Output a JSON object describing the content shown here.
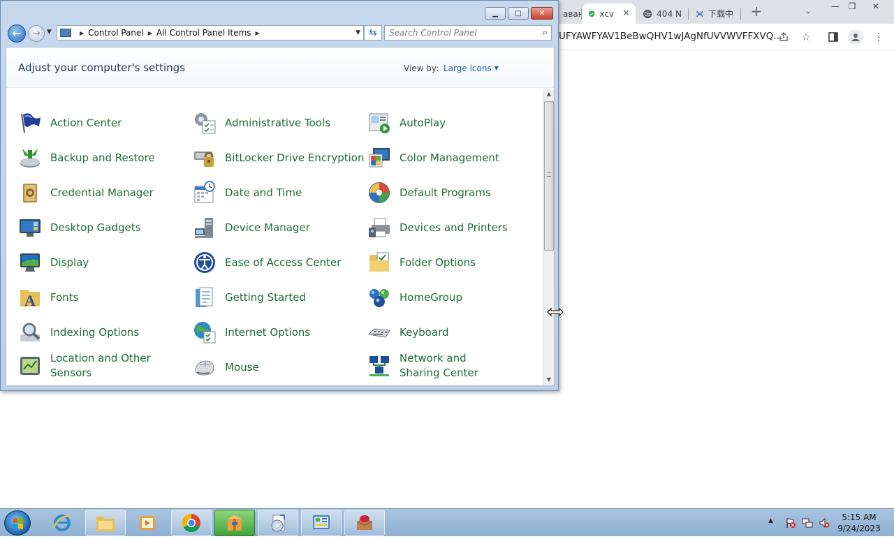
{
  "browser": {
    "tabs": [
      {
        "title": "аван",
        "close": ""
      },
      {
        "title": "xcv",
        "close": "✕"
      },
      {
        "title": "404 N",
        "close": ""
      },
      {
        "title": "下载中",
        "close": ""
      }
    ],
    "new_tab": "+",
    "tab_list": "⌄",
    "url": "UFYAWFYAV1BeBwQHV1wJAgNfUVVWVFFXVQ...",
    "controls": {
      "minimize": "—",
      "restore": "❐",
      "close": "✕"
    }
  },
  "control_panel": {
    "window_buttons": {
      "minimize": "▁",
      "maximize": "□",
      "close": "✕"
    },
    "breadcrumb": [
      "Control Panel",
      "All Control Panel Items"
    ],
    "search_placeholder": "Search Control Panel",
    "heading": "Adjust your computer's settings",
    "view_by_label": "View by:",
    "view_by_value": "Large icons",
    "items": [
      {
        "label": "Action Center",
        "icon": "flag-icon",
        "color": "#1f3f9a"
      },
      {
        "label": "Administrative Tools",
        "icon": "admin-tools-icon",
        "color": "#6b7b8c"
      },
      {
        "label": "AutoPlay",
        "icon": "autoplay-icon",
        "color": "#2f9a3c"
      },
      {
        "label": "Backup and Restore",
        "icon": "backup-icon",
        "color": "#3aa14a"
      },
      {
        "label": "BitLocker Drive Encryption",
        "icon": "bitlocker-icon",
        "color": "#c8a13a"
      },
      {
        "label": "Color Management",
        "icon": "color-management-icon",
        "color": "#e04a3a"
      },
      {
        "label": "Credential Manager",
        "icon": "credential-icon",
        "color": "#b58a3c"
      },
      {
        "label": "Date and Time",
        "icon": "calendar-icon",
        "color": "#4a7dc0"
      },
      {
        "label": "Default Programs",
        "icon": "default-programs-icon",
        "color": "#3fa54a"
      },
      {
        "label": "Desktop Gadgets",
        "icon": "gadgets-icon",
        "color": "#2f79c8"
      },
      {
        "label": "Device Manager",
        "icon": "device-manager-icon",
        "color": "#7b8794"
      },
      {
        "label": "Devices and Printers",
        "icon": "printer-icon",
        "color": "#6c7784"
      },
      {
        "label": "Display",
        "icon": "monitor-icon",
        "color": "#1f6fc8"
      },
      {
        "label": "Ease of Access Center",
        "icon": "ease-of-access-icon",
        "color": "#1f4f9a"
      },
      {
        "label": "Folder Options",
        "icon": "folder-icon",
        "color": "#e8c05a"
      },
      {
        "label": "Fonts",
        "icon": "fonts-icon",
        "color": "#e8c05a"
      },
      {
        "label": "Getting Started",
        "icon": "getting-started-icon",
        "color": "#4a9ad8"
      },
      {
        "label": "HomeGroup",
        "icon": "homegroup-icon",
        "color": "#2f6fc8"
      },
      {
        "label": "Indexing Options",
        "icon": "indexing-icon",
        "color": "#8a98a8"
      },
      {
        "label": "Internet Options",
        "icon": "globe-icon",
        "color": "#2f8ac8"
      },
      {
        "label": "Keyboard",
        "icon": "keyboard-icon",
        "color": "#6c7480"
      },
      {
        "label": "Location and Other Sensors",
        "icon": "sensors-icon",
        "color": "#6f9a3a"
      },
      {
        "label": "Mouse",
        "icon": "mouse-icon",
        "color": "#8a8f96"
      },
      {
        "label": "Network and Sharing Center",
        "icon": "network-icon",
        "color": "#1f4f9a"
      }
    ]
  },
  "taskbar": {
    "apps": [
      {
        "name": "internet-explorer",
        "active": false
      },
      {
        "name": "file-explorer",
        "active": false
      },
      {
        "name": "media-player",
        "active": false
      },
      {
        "name": "chrome",
        "active": false
      },
      {
        "name": "package",
        "active": true
      },
      {
        "name": "installer",
        "active": false
      },
      {
        "name": "control-panel",
        "active": false
      },
      {
        "name": "box-app",
        "active": false
      }
    ],
    "clock_time": "5:15 AM",
    "clock_date": "9/24/2023"
  }
}
